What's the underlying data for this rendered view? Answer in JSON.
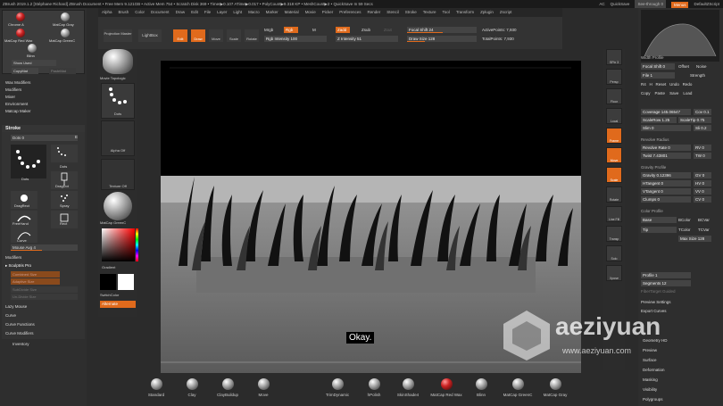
{
  "titlebar": {
    "left": "ZBrush 2019.1.2 [Stéphane Richard]   ZBrush Document   • Free Mem 9.121GB • Active Mem 754 • Scratch Disk 369 • Timer▶0.107 ATime▶0.017 • PolyCount▶9.318 KP • MeshCount▶2 • QuickSave In 59 Secs",
    "ac": "AC",
    "quicksave": "QuickSave",
    "seethrough": "See-through  0",
    "menus": "Menus",
    "script": "DefaultZScript"
  },
  "menubar": [
    "Alpha",
    "Brush",
    "Color",
    "Document",
    "Draw",
    "Edit",
    "File",
    "Layer",
    "Light",
    "Macro",
    "Marker",
    "Material",
    "Movie",
    "Picker",
    "Preferences",
    "Render",
    "Stencil",
    "Stroke",
    "Texture",
    "Tool",
    "Transform",
    "Zplugin",
    "Zscript"
  ],
  "left_panel": {
    "materials": [
      "Chrome A",
      "MatCap Gray",
      "MatCap Red Wax",
      "MatCap GreenC",
      "Blinn"
    ],
    "show_used": "Show Used",
    "copy_mat": "CopyMat",
    "paste_mat": "PasteMat",
    "menu": [
      "Wax Modifiers",
      "Modifiers",
      "Mixer",
      "Environment",
      "Matcap Maker"
    ],
    "stroke_header": "Stroke",
    "dots": "Dots  0",
    "e": "E",
    "strokes": [
      "Dots",
      "Dots",
      "DragDot",
      "Spray",
      "DragRect",
      "Rect",
      "FreeHand",
      "Curve"
    ],
    "mouse_avg": "Mouse Avg 4",
    "stroke_menu": [
      "Modifiers",
      "Sculptris Pro"
    ],
    "adaptive": [
      "Combined Size",
      "Adaptive Size",
      "SubDivide Size",
      "Un-Divide Size"
    ],
    "lower_menu": [
      "Lazy Mouse",
      "Curve",
      "Curve Functions",
      "Curve Modifiers"
    ],
    "inventory": "Inventory"
  },
  "tool_column": {
    "projection": "Projection Master",
    "lightbox": "LightBox",
    "movie_topo": "Movie Topologic",
    "dots": "Dots",
    "alpha_off": "Alpha Off",
    "texture_off": "Texture Off",
    "matcap": "MatCap GreenC",
    "gradient": "Gradient",
    "switch_color": "SwitchColor",
    "alternate": "Alternate"
  },
  "topbar": {
    "edit": "Edit",
    "draw": "Draw",
    "move": "Move",
    "scale": "Scale",
    "rotate": "Rotate",
    "mrgb": "Mrgb",
    "rgb": "Rgb",
    "m": "M",
    "rgb_intensity": "Rgb Intensity 100",
    "zadd": "Zadd",
    "zsub": "Zsub",
    "zcut": "Zcut",
    "z_intensity": "Z Intensity 51",
    "focal_shift": "Focal Shift 24",
    "draw_size": "Draw Size 128",
    "active_points": "ActivePoints: 7,930",
    "total_points": "TotalPoints: 7,930"
  },
  "right_column": [
    "SPix 3",
    "Persp",
    "Floor",
    "Local",
    "Frame",
    "Move",
    "Scale",
    "Rotate",
    "Line Fill",
    "Transp",
    "Solo",
    "Xpose"
  ],
  "right_panel": {
    "width_profile": "Width Profile",
    "focal_shift": "Focal Shift 0",
    "offset": "Offset",
    "noise": "Noise",
    "file": "File 1",
    "strength": "Strength",
    "row1": [
      "R4",
      "H",
      "Reset",
      "Undo",
      "Redo"
    ],
    "row2": [
      "Copy",
      "Paste",
      "Save",
      "Load"
    ],
    "coverage": "Coverage 145.06547",
    "cov": "Cov 0.1",
    "scalerow": "ScaleRow 1.25",
    "scaletp": "ScaleTip 0.75",
    "slim": "Slim 0",
    "sli": "Sli 0.2",
    "revolve_radius": "Revolve Radius",
    "revolve_rate": "Revolve Rate 0",
    "rv": "RV 0",
    "twist": "Twist 7.43801",
    "tw": "TW 0",
    "gravity_profile": "Gravity Profile",
    "gravity": "Gravity 0.12396",
    "gv": "GV 0",
    "htangent": "HTangent 0",
    "hv": "HV 0",
    "vtangent": "VTangent 0",
    "vv": "VV 0",
    "clumps": "Clumps 0",
    "cv": "CV 0",
    "color_profile": "Color Profile",
    "base": "Base",
    "bcolor": "BColor",
    "bcvar": "BCVar",
    "tip": "Tip",
    "tcolor": "TColor",
    "tcvar": "TCVar",
    "max_size": "Max Size 128",
    "profile": "Profile 1",
    "segments": "Segments 12",
    "fiber_target": "FiberTarget Guided",
    "preview_settings": "Preview Settings",
    "export_curves": "Export Curves",
    "lower": [
      "Geometry HD",
      "Preview",
      "Surface",
      "Deformation",
      "Masking",
      "Visibility",
      "Polygroups"
    ]
  },
  "bottom_shelf": [
    "Standard",
    "Clay",
    "ClayBuildup",
    "Move",
    "TrimDynamic",
    "hPolish",
    "SkinShade4",
    "MatCap Red Wax",
    "Blinn",
    "MatCap GreenC",
    "MatCap Gray"
  ],
  "caption": "Okay.",
  "watermark": "aeziyuan",
  "watermark_url": "www.aeziyuan.com"
}
